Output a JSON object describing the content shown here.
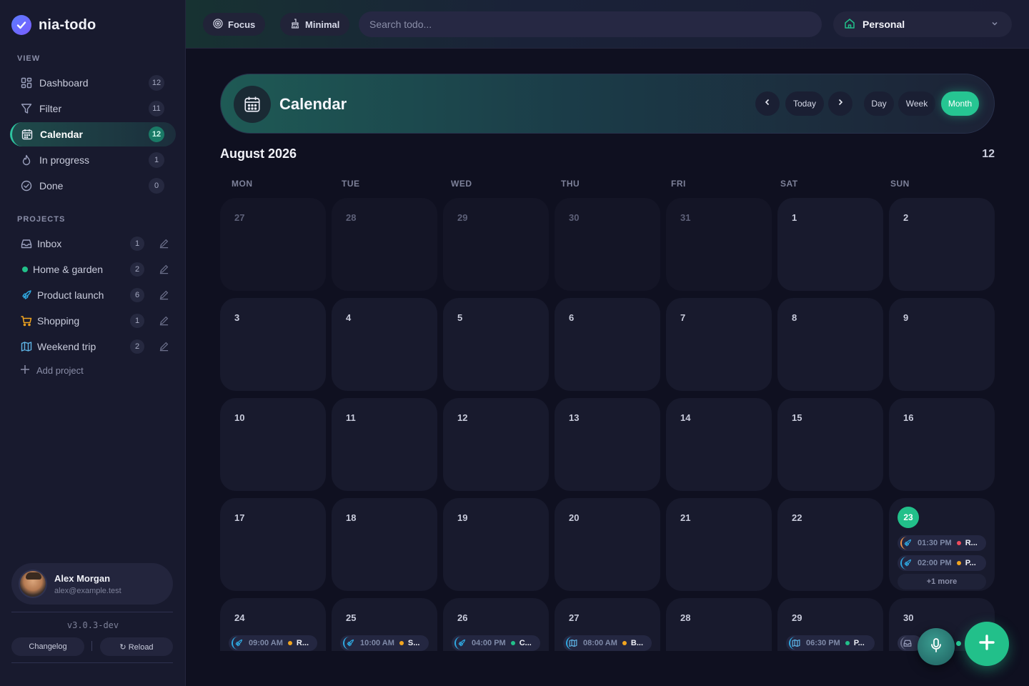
{
  "app": {
    "name": "nia-todo"
  },
  "sidebar": {
    "view_label": "VIEW",
    "view_items": [
      {
        "label": "Dashboard",
        "count": "12",
        "icon": "dashboard-icon"
      },
      {
        "label": "Filter",
        "count": "11",
        "icon": "filter-icon"
      },
      {
        "label": "Calendar",
        "count": "12",
        "icon": "calendar-icon",
        "active": true
      },
      {
        "label": "In progress",
        "count": "1",
        "icon": "flame-icon"
      },
      {
        "label": "Done",
        "count": "0",
        "icon": "check-circle-icon"
      }
    ],
    "projects_label": "PROJECTS",
    "projects": [
      {
        "label": "Inbox",
        "count": "1",
        "icon": "inbox-icon",
        "color": "#9aa0bd"
      },
      {
        "label": "Home & garden",
        "count": "2",
        "icon": "dot-icon",
        "color": "#22c08a"
      },
      {
        "label": "Product launch",
        "count": "6",
        "icon": "rocket-icon",
        "color": "#2fa8e0"
      },
      {
        "label": "Shopping",
        "count": "1",
        "icon": "cart-icon",
        "color": "#f2a51f"
      },
      {
        "label": "Weekend trip",
        "count": "2",
        "icon": "map-icon",
        "color": "#5fb6e8"
      }
    ],
    "add_project": "Add project",
    "user": {
      "name": "Alex Morgan",
      "email": "alex@example.test"
    },
    "version": "v3.0.3-dev",
    "changelog": "Changelog",
    "reload": "↻ Reload"
  },
  "topbar": {
    "focus": "Focus",
    "minimal": "Minimal",
    "search_placeholder": "Search todo...",
    "workspace": "Personal"
  },
  "calendar": {
    "title": "Calendar",
    "today": "Today",
    "day": "Day",
    "week": "Week",
    "month": "Month",
    "active_view": "Month",
    "month_title": "August 2026",
    "count": "12",
    "weekdays": [
      "MON",
      "TUE",
      "WED",
      "THU",
      "FRI",
      "SAT",
      "SUN"
    ],
    "today_date": "23",
    "weeks": [
      [
        "27",
        "28",
        "29",
        "30",
        "31",
        "1",
        "2"
      ],
      [
        "3",
        "4",
        "5",
        "6",
        "7",
        "8",
        "9"
      ],
      [
        "10",
        "11",
        "12",
        "13",
        "14",
        "15",
        "16"
      ],
      [
        "17",
        "18",
        "19",
        "20",
        "21",
        "22",
        "23"
      ],
      [
        "24",
        "25",
        "26",
        "27",
        "28",
        "29",
        "30"
      ]
    ],
    "events": {
      "3-6": [
        {
          "time": "01:30 PM",
          "title": "R...",
          "dot": "#ef4b5c",
          "icon": "rocket-icon"
        },
        {
          "time": "02:00 PM",
          "title": "P...",
          "dot": "#f2a51f",
          "icon": "rocket-icon"
        }
      ],
      "4-0": [
        {
          "time": "09:00 AM",
          "title": "R...",
          "dot": "#f2a51f",
          "icon": "rocket-icon"
        }
      ],
      "4-1": [
        {
          "time": "10:00 AM",
          "title": "S...",
          "dot": "#f2a51f",
          "icon": "rocket-icon"
        }
      ],
      "4-2": [
        {
          "time": "04:00 PM",
          "title": "C...",
          "dot": "#22c08a",
          "icon": "rocket-icon"
        }
      ],
      "4-3": [
        {
          "time": "08:00 AM",
          "title": "B...",
          "dot": "#f2a51f",
          "icon": "map-icon"
        }
      ],
      "4-5": [
        {
          "time": "06:30 PM",
          "title": "P...",
          "dot": "#22c08a",
          "icon": "map-icon"
        }
      ],
      "4-6": [
        {
          "time": "",
          "title": "",
          "dot": "#22c08a",
          "icon": "inbox-icon"
        }
      ]
    },
    "more_label": "+1 more"
  },
  "colors": {
    "accent": "#22c08a",
    "background": "#0f1020",
    "sidebar": "#181a2e"
  }
}
